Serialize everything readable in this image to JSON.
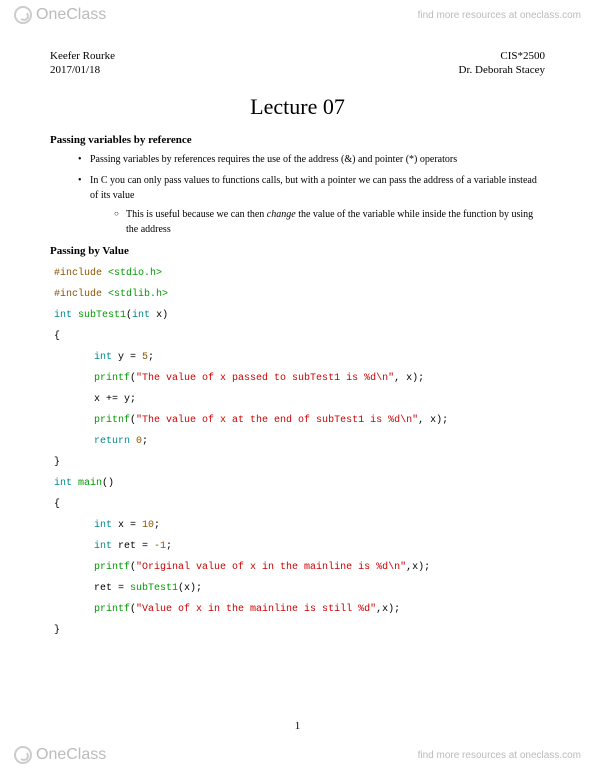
{
  "branding": {
    "logo_text": "OneClass",
    "find_more": "find more resources at oneclass.com"
  },
  "header": {
    "author": "Keefer Rourke",
    "course": "CIS*2500",
    "date": "2017/01/18",
    "instructor": "Dr. Deborah Stacey"
  },
  "title": "Lecture 07",
  "sections": {
    "s1": "Passing variables by reference",
    "s2": "Passing by Value"
  },
  "bullets": {
    "b1": "Passing variables by references requires the use of the address (&) and pointer (*) operators",
    "b2": "In C you can only pass values to functions calls, but with a pointer we can pass the address of a variable instead of its value",
    "b2a_pre": "This is useful because we can then ",
    "b2a_em": "change",
    "b2a_post": " the value of the variable while inside the function by using the address"
  },
  "code": {
    "inc1_a": "#include",
    "inc1_b": " <stdio.h>",
    "inc2_a": "#include",
    "inc2_b": " <stdlib.h>",
    "fn1_a": "int",
    "fn1_b": " subTest1",
    "fn1_c": "(",
    "fn1_d": "int",
    "fn1_e": " x",
    "fn1_f": ")",
    "ob": "{",
    "cb": "}",
    "l1_a": "int",
    "l1_b": " y = ",
    "l1_c": "5",
    "l1_d": ";",
    "l2_a": "printf",
    "l2_b": "(",
    "l2_c": "\"The value of x passed to subTest1 is %d\\n\"",
    "l2_d": ", x);",
    "l3": "x += y;",
    "l4_a": "pritnf",
    "l4_b": "(",
    "l4_c": "\"The value of x at the end of subTest1 is %d\\n\"",
    "l4_d": ", x);",
    "l5_a": "return",
    "l5_b": " 0",
    "l5_c": ";",
    "fn2_a": "int",
    "fn2_b": " main",
    "fn2_c": "()",
    "m1_a": "int",
    "m1_b": " x = ",
    "m1_c": "10",
    "m1_d": ";",
    "m2_a": "int",
    "m2_b": " ret = ",
    "m2_c": "-1",
    "m2_d": ";",
    "m3_a": "printf",
    "m3_b": "(",
    "m3_c": "\"Original value of x in the mainline is %d\\n\"",
    "m3_d": ",x);",
    "m4_a": "ret = ",
    "m4_b": "subTest1",
    "m4_c": "(x);",
    "m5_a": "printf",
    "m5_b": "(",
    "m5_c": "\"Value of x in the mainline is still %d\"",
    "m5_d": ",x);"
  },
  "page_number": "1"
}
